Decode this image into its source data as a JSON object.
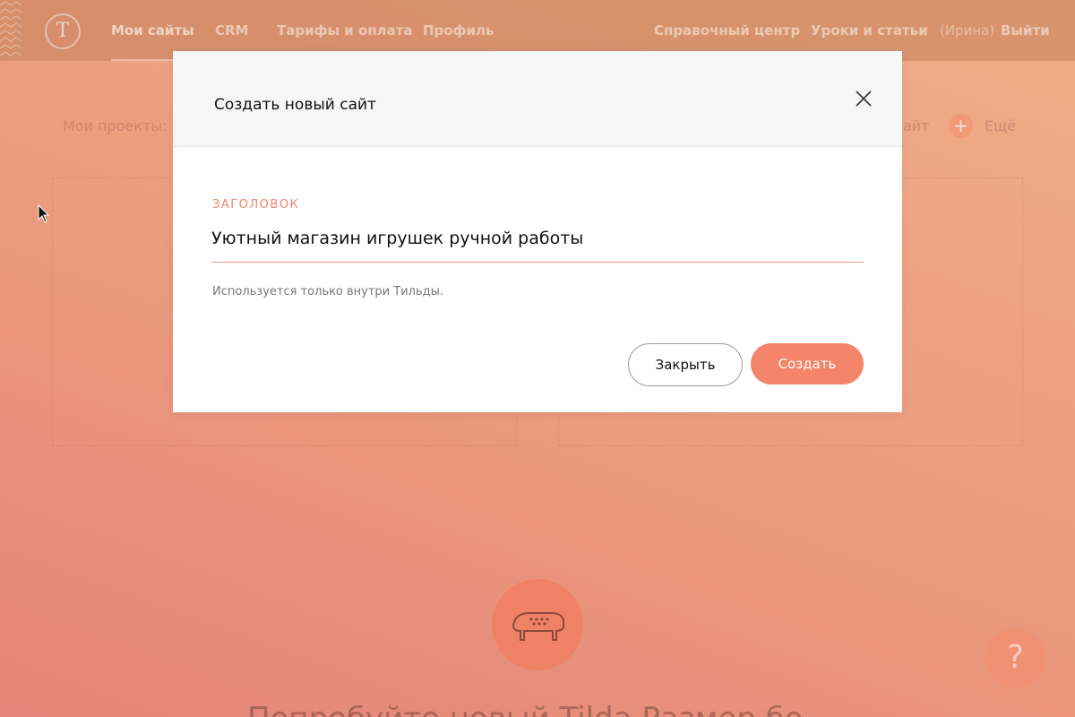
{
  "colors": {
    "accent": "#f5856a",
    "label": "#f0856a",
    "nav_overlay": "#c4805a"
  },
  "nav": {
    "logo_icon": "tilda-t-logo-icon",
    "items": [
      {
        "label": "Мои сайты",
        "active": true
      },
      {
        "label": "CRM"
      },
      {
        "label": "Тарифы и оплата"
      },
      {
        "label": "Профиль"
      }
    ],
    "right": {
      "help": "Справочный центр",
      "lessons": "Уроки и статьи",
      "user": "(Ирина)",
      "logout": "Выйти"
    }
  },
  "page": {
    "projects_label": "Мои проекты:",
    "create_site_partial": "айт",
    "more_label": "Ещё",
    "help_icon": "?",
    "bottom_title_partial": "Попробуйте новый Tilda Размер бо"
  },
  "modal": {
    "title": "Создать новый сайт",
    "close_icon": "close-icon",
    "field_label": "ЗАГОЛОВОК",
    "field_value": "Уютный магазин игрушек ручной работы",
    "field_hint": "Используется только внутри Тильды.",
    "close_button": "Закрыть",
    "create_button": "Создать"
  }
}
